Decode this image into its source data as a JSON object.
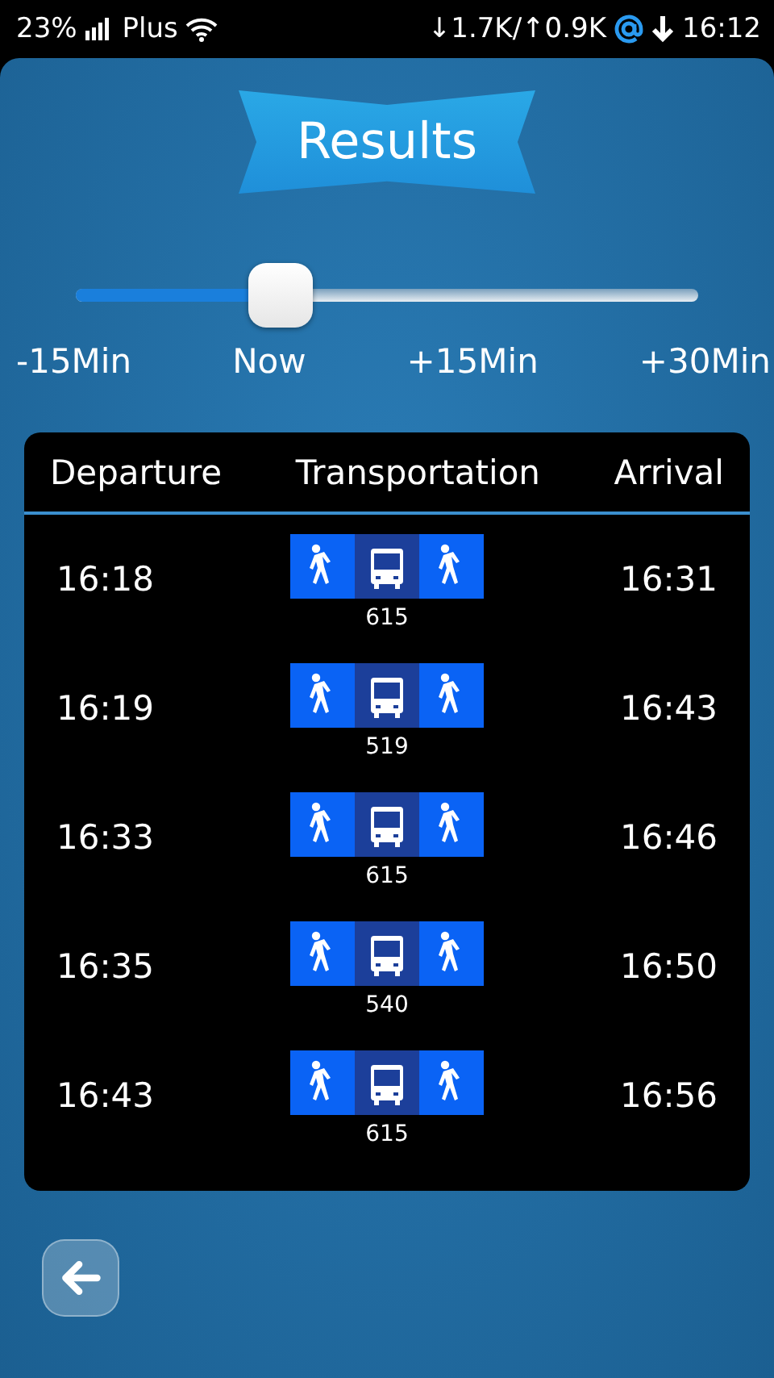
{
  "status_bar": {
    "battery": "23%",
    "carrier": "Plus",
    "traffic": "↓1.7K/↑0.9K",
    "time": "16:12"
  },
  "title": "Results",
  "time_slider": {
    "level": 0.33,
    "labels": [
      "-15Min",
      "Now",
      "+15Min",
      "+30Min"
    ]
  },
  "table": {
    "columns": [
      "Departure",
      "Transportation",
      "Arrival"
    ],
    "rows": [
      {
        "departure": "16:18",
        "legs": [
          {
            "kind": "walk"
          },
          {
            "kind": "bus"
          },
          {
            "kind": "walk"
          }
        ],
        "line": "615",
        "arrival": "16:31"
      },
      {
        "departure": "16:19",
        "legs": [
          {
            "kind": "walk"
          },
          {
            "kind": "bus"
          },
          {
            "kind": "walk"
          }
        ],
        "line": "519",
        "arrival": "16:43"
      },
      {
        "departure": "16:33",
        "legs": [
          {
            "kind": "walk"
          },
          {
            "kind": "bus"
          },
          {
            "kind": "walk"
          }
        ],
        "line": "615",
        "arrival": "16:46"
      },
      {
        "departure": "16:35",
        "legs": [
          {
            "kind": "walk"
          },
          {
            "kind": "bus"
          },
          {
            "kind": "walk"
          }
        ],
        "line": "540",
        "arrival": "16:50"
      },
      {
        "departure": "16:43",
        "legs": [
          {
            "kind": "walk"
          },
          {
            "kind": "bus"
          },
          {
            "kind": "walk"
          }
        ],
        "line": "615",
        "arrival": "16:56"
      }
    ]
  }
}
